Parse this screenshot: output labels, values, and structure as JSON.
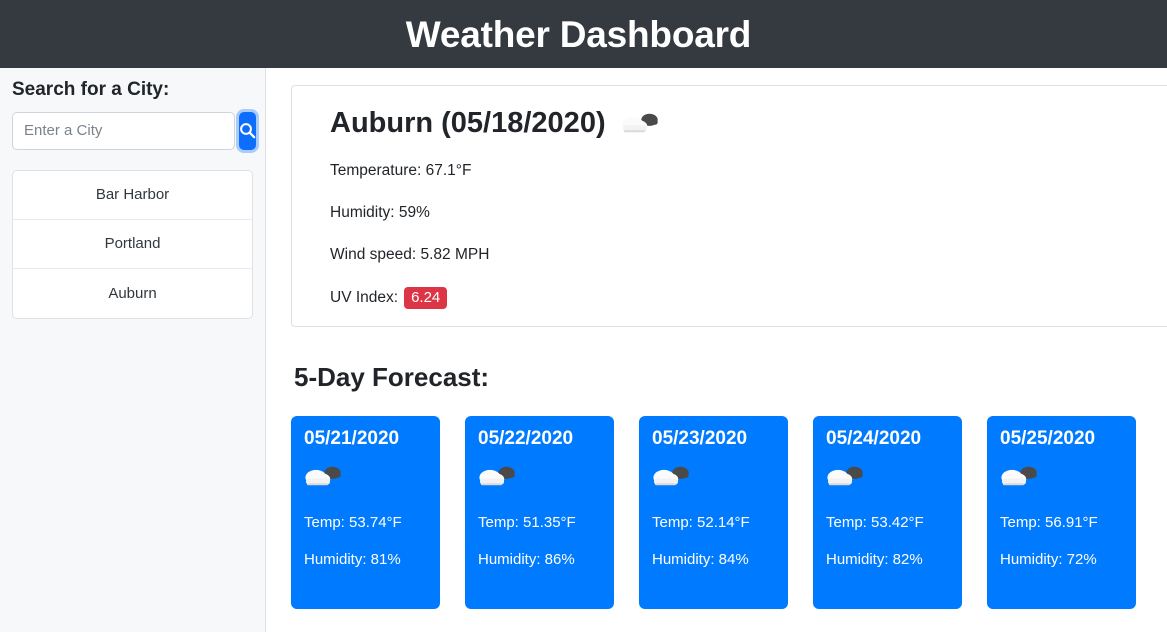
{
  "header": {
    "title": "Weather Dashboard",
    "background_color": "#343a40"
  },
  "sidebar": {
    "heading": "Search for a City:",
    "search": {
      "placeholder": "Enter a City",
      "value": "",
      "button_icon": "search-icon",
      "button_color": "#0d6efd"
    },
    "cities": [
      {
        "name": "Bar Harbor"
      },
      {
        "name": "Portland"
      },
      {
        "name": "Auburn"
      }
    ]
  },
  "current_weather": {
    "title": "Auburn (05/18/2020)",
    "icon": "broken-clouds-icon",
    "temperature": "Temperature: 67.1°F",
    "humidity": "Humidity: 59%",
    "wind_speed": "Wind speed: 5.82 MPH",
    "uv_label": "UV Index:",
    "uv_value": "6.24",
    "uv_badge_color": "#dc3545"
  },
  "forecast": {
    "heading": "5-Day Forecast:",
    "card_color": "#007bff",
    "days": [
      {
        "date": "05/21/2020",
        "icon": "broken-clouds-icon",
        "temp": "Temp: 53.74°F",
        "humidity": "Humidity: 81%"
      },
      {
        "date": "05/22/2020",
        "icon": "broken-clouds-icon",
        "temp": "Temp: 51.35°F",
        "humidity": "Humidity: 86%"
      },
      {
        "date": "05/23/2020",
        "icon": "broken-clouds-icon",
        "temp": "Temp: 52.14°F",
        "humidity": "Humidity: 84%"
      },
      {
        "date": "05/24/2020",
        "icon": "broken-clouds-icon",
        "temp": "Temp: 53.42°F",
        "humidity": "Humidity: 82%"
      },
      {
        "date": "05/25/2020",
        "icon": "broken-clouds-icon",
        "temp": "Temp: 56.91°F",
        "humidity": "Humidity: 72%"
      }
    ]
  }
}
